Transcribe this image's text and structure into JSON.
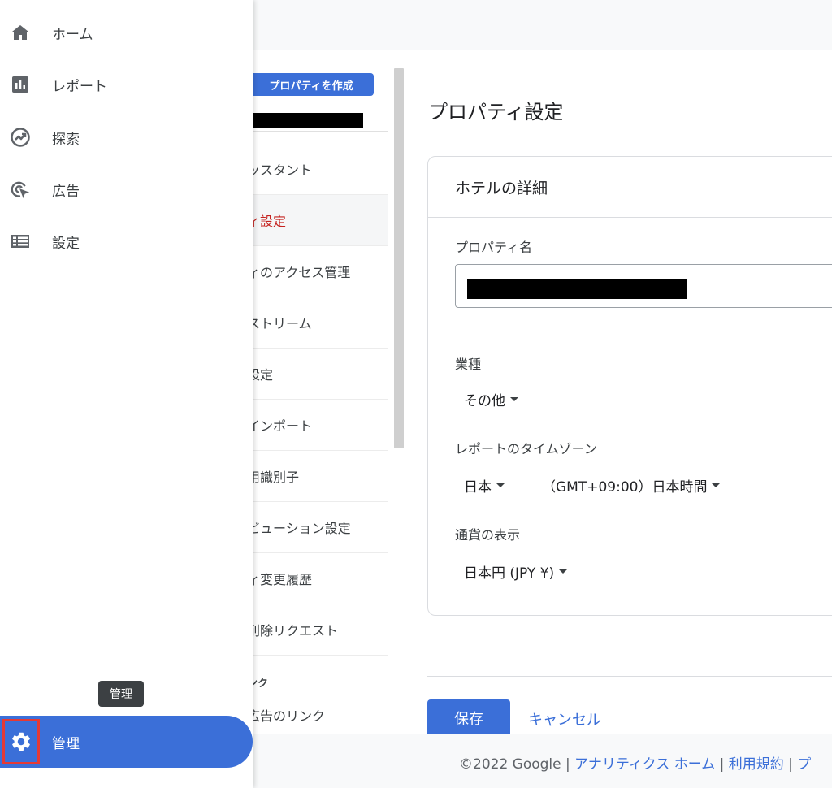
{
  "nav": {
    "items": [
      {
        "label": "ホーム",
        "icon": "home-icon"
      },
      {
        "label": "レポート",
        "icon": "bar-chart-icon"
      },
      {
        "label": "探索",
        "icon": "explore-icon"
      },
      {
        "label": "広告",
        "icon": "ads-icon"
      },
      {
        "label": "設定",
        "icon": "configure-icon"
      }
    ],
    "admin_label": "管理",
    "admin_tooltip": "管理",
    "accent_color": "#3b6fd8",
    "highlight_color": "#e53935"
  },
  "admin_column": {
    "create_property_label": "プロパティを作成",
    "items": [
      "ッスタント",
      "ィ設定",
      "ィのアクセス管理",
      "ストリーム",
      "設定",
      "インポート",
      "用識別子",
      "ビューション設定",
      "ィ変更履歴",
      "削除リクエスト"
    ],
    "active_index": 1,
    "section_label": "ンク",
    "last_item": "広告のリンク"
  },
  "main": {
    "page_title": "プロパティ設定",
    "card_title": "ホテルの詳細",
    "property_name_label": "プロパティ名",
    "industry_label": "業種",
    "industry_value": "その他",
    "timezone_label": "レポートのタイムゾーン",
    "timezone_country": "日本",
    "timezone_value": "（GMT+09:00）日本時間",
    "currency_label": "通貨の表示",
    "currency_value": "日本円 (JPY ¥)",
    "save_label": "保存",
    "cancel_label": "キャンセル"
  },
  "footer": {
    "copyright": "©2022 Google",
    "sep": " | ",
    "links": [
      "アナリティクス ホーム",
      "利用規約",
      "プ"
    ]
  }
}
